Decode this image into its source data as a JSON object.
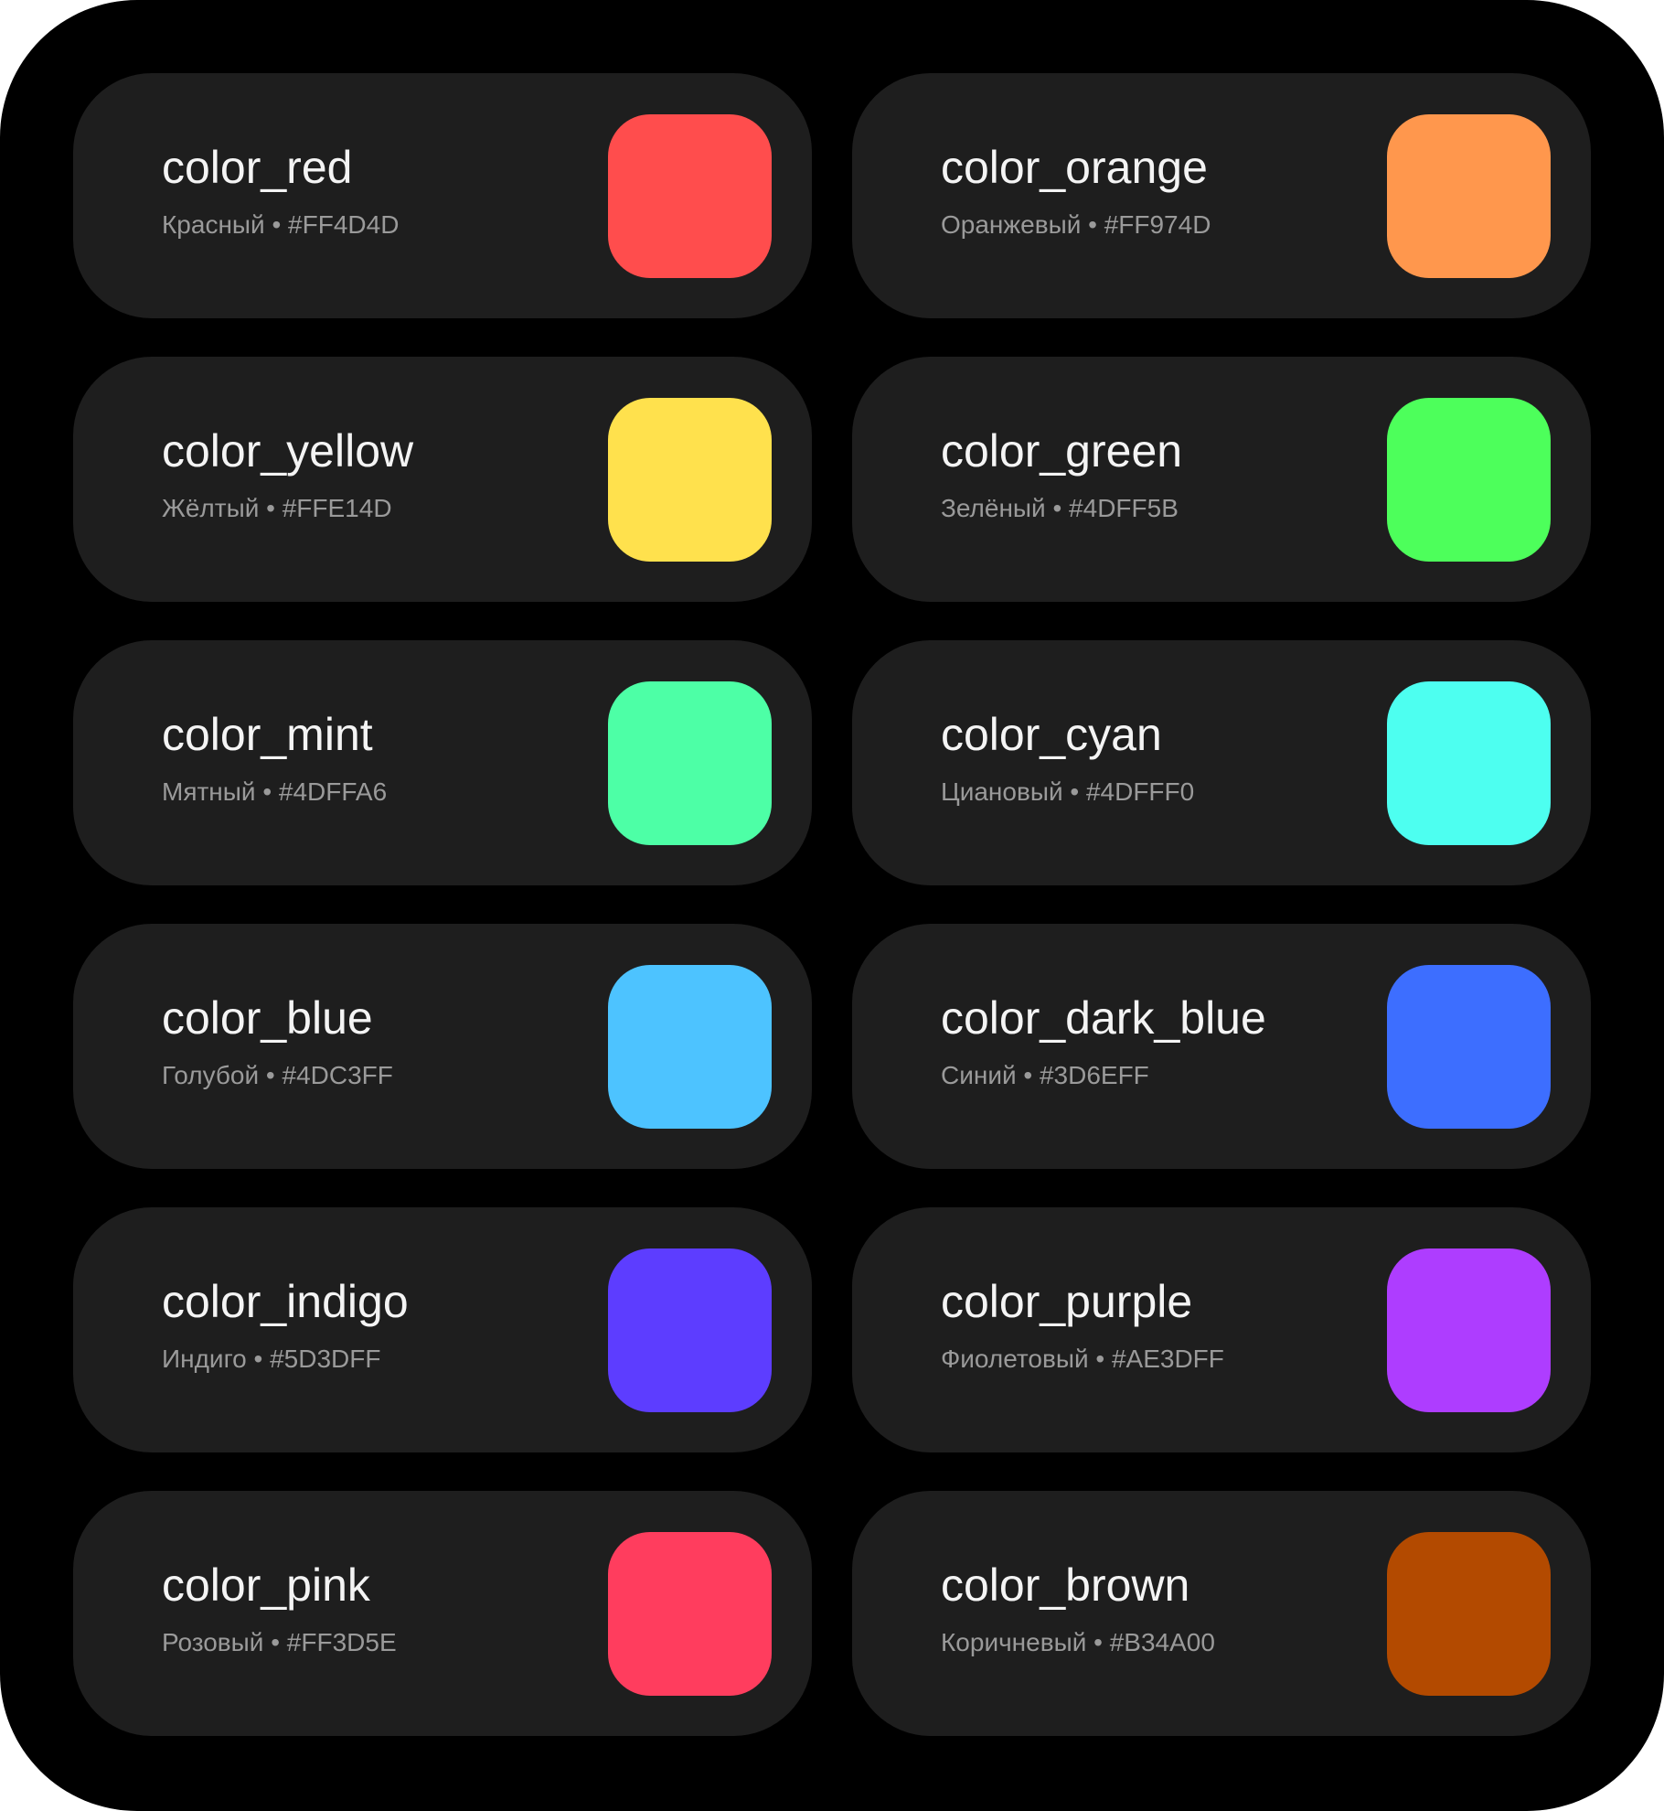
{
  "colors": [
    {
      "name": "color_red",
      "label": "Красный • #FF4D4D",
      "hex": "#FF4D4D"
    },
    {
      "name": "color_orange",
      "label": "Оранжевый • #FF974D",
      "hex": "#FF974D"
    },
    {
      "name": "color_yellow",
      "label": "Жёлтый • #FFE14D",
      "hex": "#FFE14D"
    },
    {
      "name": "color_green",
      "label": "Зелёный • #4DFF5B",
      "hex": "#4DFF5B"
    },
    {
      "name": "color_mint",
      "label": "Мятный • #4DFFA6",
      "hex": "#4DFFA6"
    },
    {
      "name": "color_cyan",
      "label": "Циановый • #4DFFF0",
      "hex": "#4DFFF0"
    },
    {
      "name": "color_blue",
      "label": "Голубой • #4DC3FF",
      "hex": "#4DC3FF"
    },
    {
      "name": "color_dark_blue",
      "label": "Синий • #3D6EFF",
      "hex": "#3D6EFF"
    },
    {
      "name": "color_indigo",
      "label": "Индиго • #5D3DFF",
      "hex": "#5D3DFF"
    },
    {
      "name": "color_purple",
      "label": "Фиолетовый • #AE3DFF",
      "hex": "#AE3DFF"
    },
    {
      "name": "color_pink",
      "label": "Розовый • #FF3D5E",
      "hex": "#FF3D5E"
    },
    {
      "name": "color_brown",
      "label": "Коричневый • #B34A00",
      "hex": "#B34A00"
    }
  ],
  "theme": {
    "background": "#000000",
    "card": "#1E1E1E",
    "title_text": "#F4F4F4",
    "subtitle_text": "#9A9A9A"
  }
}
